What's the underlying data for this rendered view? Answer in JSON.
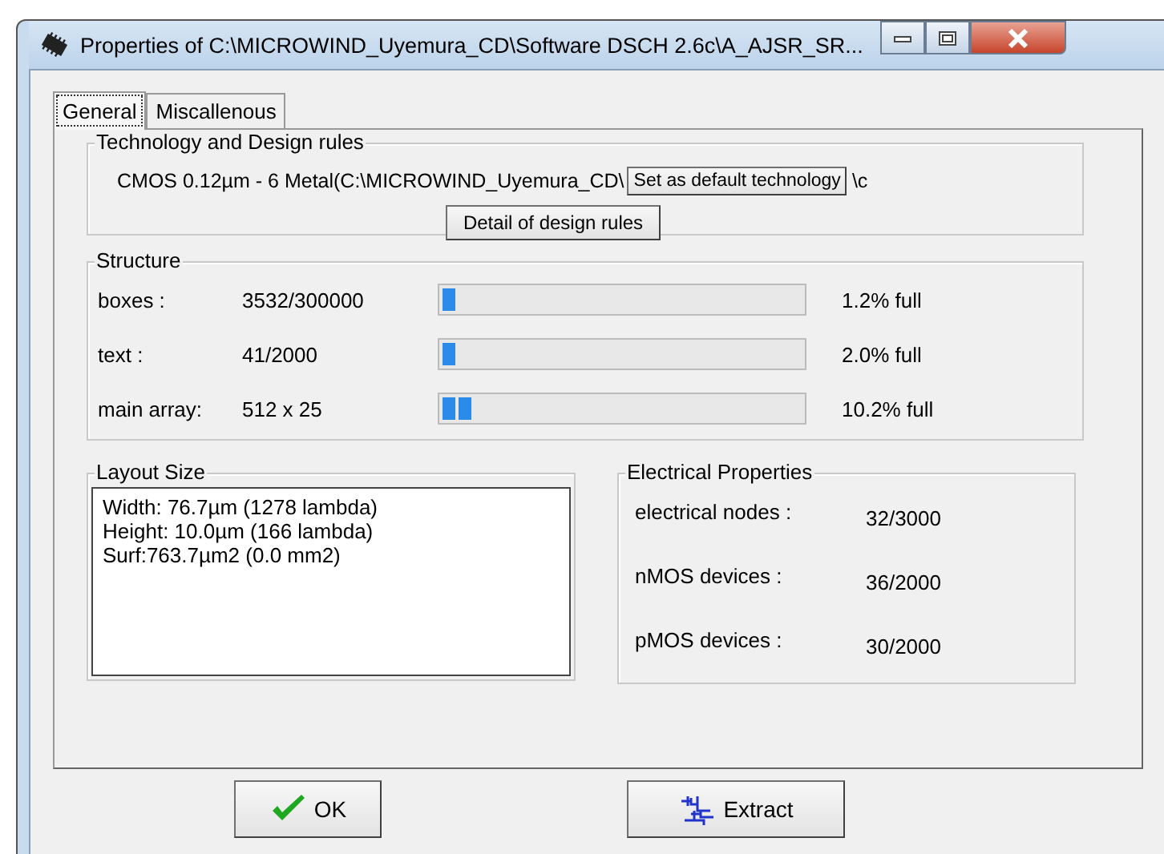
{
  "window": {
    "title": "Properties of C:\\MICROWIND_Uyemura_CD\\Software DSCH 2.6c\\A_AJSR_SR..."
  },
  "tabs": [
    {
      "label": "General",
      "selected": true
    },
    {
      "label": "Miscallenous",
      "selected": false
    }
  ],
  "technology": {
    "title": "Technology and Design rules",
    "line": "CMOS 0.12µm - 6 Metal(C:\\MICROWIND_Uyemura_CD\\",
    "line_tail": "\\c",
    "default_button": "Set as default technology",
    "detail_button": "Detail of design rules"
  },
  "structure": {
    "title": "Structure",
    "rows": [
      {
        "label": "boxes :",
        "count": "3532/300000",
        "level": 0.012,
        "reading": "1.2% full"
      },
      {
        "label": "text :",
        "count": "41/2000",
        "level": 0.02,
        "reading": "2.0% full"
      },
      {
        "label": "main array:",
        "count": "512 x 25",
        "level": 0.102,
        "reading": "10.2% full"
      }
    ]
  },
  "layout_size": {
    "title": "Layout Size",
    "lines": [
      "Width: 76.7µm (1278 lambda)",
      "Height: 10.0µm (166 lambda)",
      "Surf:763.7µm2 (0.0 mm2)"
    ]
  },
  "electrical": {
    "title": "Electrical Properties",
    "rows": [
      {
        "label": "electrical nodes :",
        "value": "32/3000"
      },
      {
        "label": "nMOS devices :",
        "value": "36/2000"
      },
      {
        "label": "pMOS devices :",
        "value": "30/2000"
      }
    ]
  },
  "buttons": [
    {
      "label": "OK",
      "kind": "ok"
    },
    {
      "label": "Extract",
      "kind": "extract"
    }
  ]
}
